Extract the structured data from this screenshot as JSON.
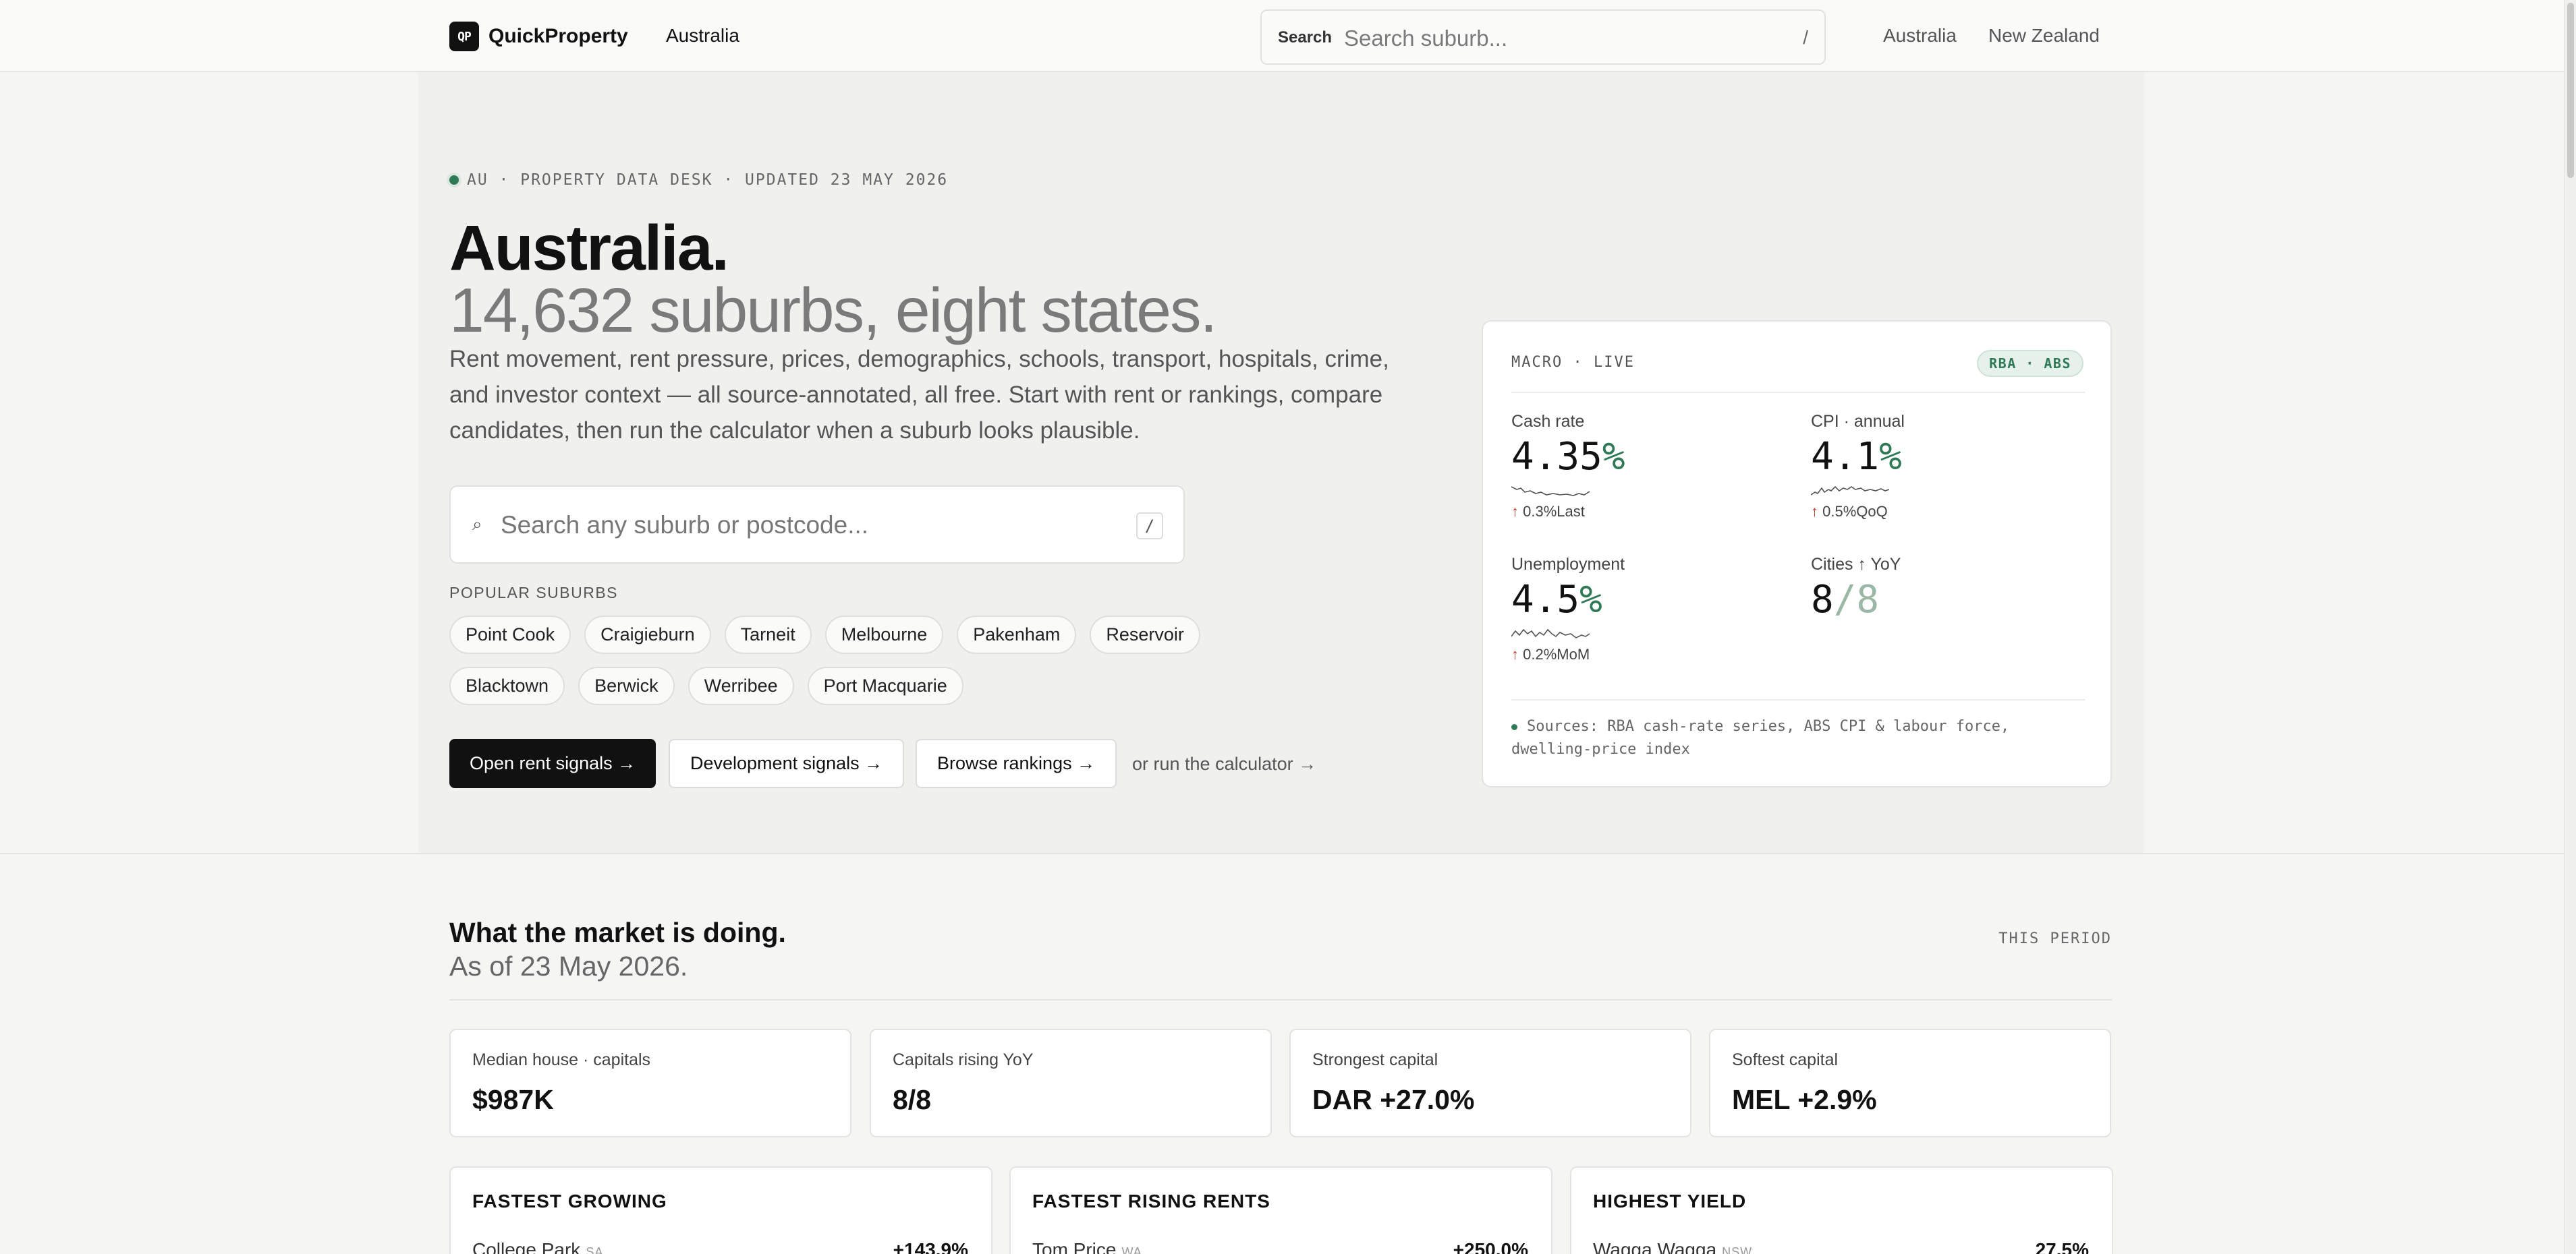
{
  "nav": {
    "logo_mark": "QP",
    "logo_text": "QuickProperty",
    "country": "Australia",
    "search_label": "Search",
    "search_placeholder": "Search suburb...",
    "search_shortcut": "/",
    "links": [
      "Australia",
      "New Zealand"
    ]
  },
  "hero": {
    "eyebrow": "AU · PROPERTY DATA DESK · UPDATED 23 MAY 2026",
    "title": "Australia.",
    "subtitle": "14,632 suburbs, eight states.",
    "lede": "Rent movement, rent pressure, prices, demographics, schools, transport, hospitals, crime, and investor context — all source-annotated, all free. Start with rent or rankings, compare candidates, then run the calculator when a suburb looks plausible.",
    "search_placeholder": "Search any suburb or postcode...",
    "search_shortcut": "/",
    "popular_label": "POPULAR SUBURBS",
    "popular": [
      "Point Cook",
      "Craigieburn",
      "Tarneit",
      "Melbourne",
      "Pakenham",
      "Reservoir",
      "Blacktown",
      "Berwick",
      "Werribee",
      "Port Macquarie"
    ],
    "buttons": {
      "rent": "Open rent signals →",
      "dev": "Development signals →",
      "rank": "Browse rankings →",
      "calc": "or run the calculator →"
    }
  },
  "macro": {
    "header": "MACRO · LIVE",
    "badge": "RBA · ABS",
    "cash": {
      "label": "Cash rate",
      "value": "4.35",
      "unit": "%",
      "change": "0.3%",
      "period": "Last"
    },
    "cpi": {
      "label": "CPI · annual",
      "value": "4.1",
      "unit": "%",
      "change": "0.5%",
      "period": "QoQ"
    },
    "unemp": {
      "label": "Unemployment",
      "value": "4.5",
      "unit": "%",
      "change": "0.2%",
      "period": "MoM"
    },
    "cities": {
      "label": "Cities ↑ YoY",
      "value": "8",
      "total": "/8"
    },
    "sources": "Sources: RBA cash-rate series, ABS CPI & labour force, dwelling-price index"
  },
  "market": {
    "title": "What the market is doing.",
    "subtitle": "As of 23 May 2026.",
    "period": "THIS PERIOD",
    "stats": [
      {
        "label": "Median house · capitals",
        "value": "$987K"
      },
      {
        "label": "Capitals rising YoY",
        "value": "8/8"
      },
      {
        "label": "Strongest capital",
        "value": "DAR +27.0%"
      },
      {
        "label": "Softest capital",
        "value": "MEL +2.9%"
      }
    ],
    "lists": [
      {
        "title": "FASTEST GROWING",
        "suburb": "College Park",
        "state": "SA",
        "value": "+143.9%"
      },
      {
        "title": "FASTEST RISING RENTS",
        "suburb": "Tom Price",
        "state": "WA",
        "value": "+250.0%"
      },
      {
        "title": "HIGHEST YIELD",
        "suburb": "Wagga Wagga",
        "state": "NSW",
        "value": "27.5%"
      }
    ]
  },
  "colors": {
    "accent": "#2f7a56",
    "up": "#c0392b",
    "dark": "#111111"
  }
}
